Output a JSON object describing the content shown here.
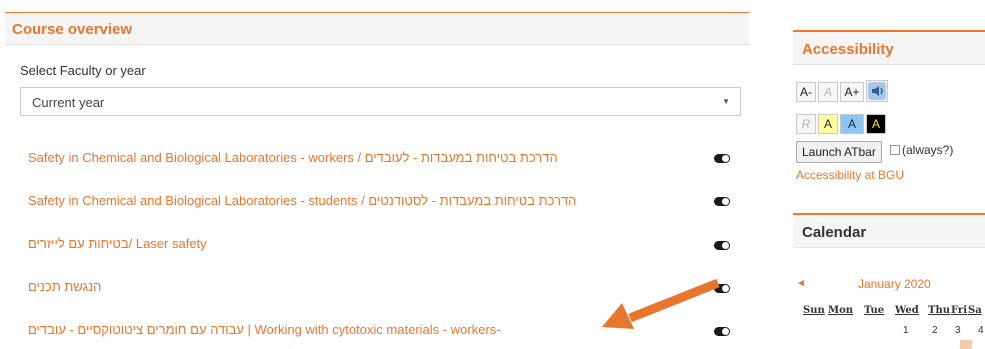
{
  "course_overview": {
    "title": "Course overview",
    "filter_label": "Select Faculty or year",
    "filter_value": "Current year",
    "filter_caret": "▼",
    "courses": [
      "Safety in Chemical and Biological Laboratories - workers / הדרכת בטיחות במעבדות - לעובדים",
      "Safety in Chemical and Biological Laboratories - students / הדרכת בטיחות במעבדות - לסטודנטים",
      "בטיחות עם לייזרים/ Laser safety",
      "הנגשת תכנים",
      "עבודה עם חומרים ציטוטוקסיים - עובדים | Working with cytotoxic materials - workers-"
    ]
  },
  "annotation": {
    "color": "#e8762c",
    "icon": "arrow-left-icon"
  },
  "accessibility": {
    "title": "Accessibility",
    "buttons_row1": [
      "A-",
      "A",
      "A+"
    ],
    "buttons_row2": [
      "R",
      "A",
      "A",
      "A"
    ],
    "launch_label": "Launch ATbar",
    "always_label": "(always?)",
    "link": "Accessibility at BGU"
  },
  "calendar": {
    "title": "Calendar",
    "prev_icon": "◄",
    "month": "January 2020",
    "days": [
      "Sun",
      "Mon",
      "Tue",
      "Wed",
      "Thu",
      "Fri",
      "Sa"
    ],
    "dates": [
      "1",
      "2",
      "3",
      "4"
    ]
  },
  "colors": {
    "accent": "#e8762c",
    "header_bg": "#f5f5f5",
    "toggle": "#1a1a1a"
  }
}
